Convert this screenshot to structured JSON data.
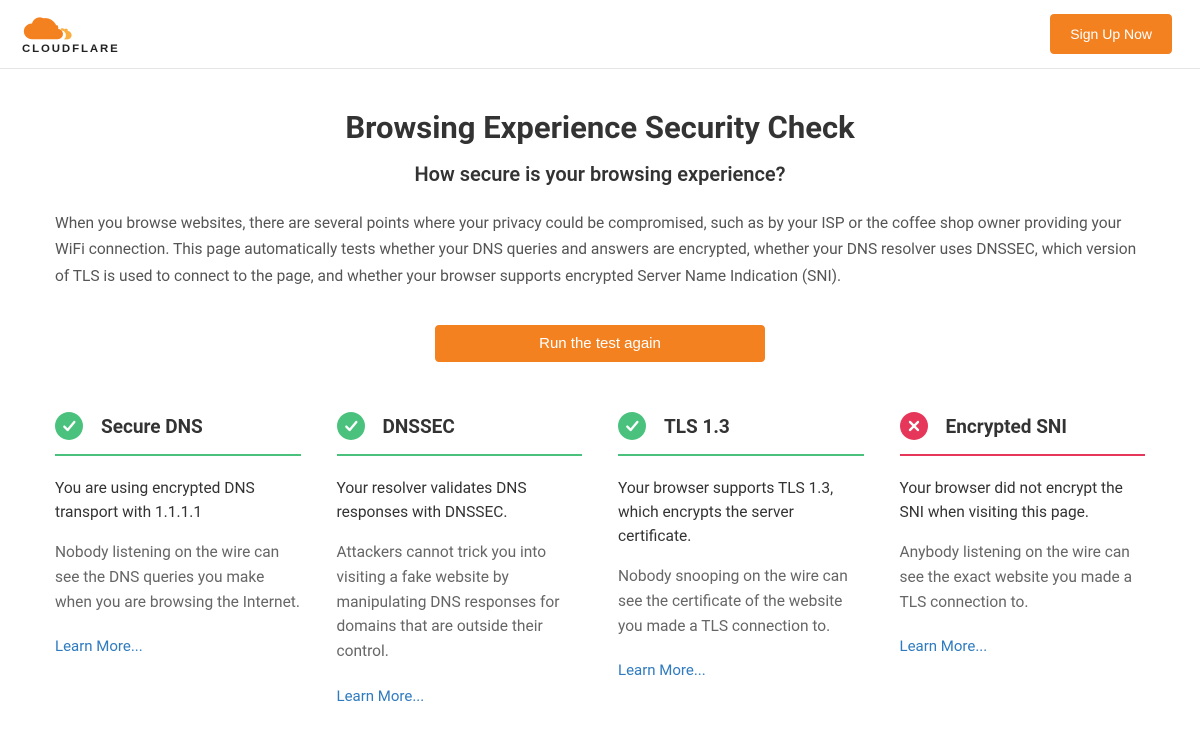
{
  "header": {
    "logo_text": "CLOUDFLARE",
    "signup_label": "Sign Up Now"
  },
  "page": {
    "title": "Browsing Experience Security Check",
    "subtitle": "How secure is your browsing experience?",
    "intro": "When you browse websites, there are several points where your privacy could be compromised, such as by your ISP or the coffee shop owner providing your WiFi connection. This page automatically tests whether your DNS queries and answers are encrypted, whether your DNS resolver uses DNSSEC, which version of TLS is used to connect to the page, and whether your browser supports encrypted Server Name Indication (SNI).",
    "run_test_label": "Run the test again"
  },
  "cards": [
    {
      "status": "success",
      "title": "Secure DNS",
      "summary": "You are using encrypted DNS transport with 1.1.1.1",
      "detail": "Nobody listening on the wire can see the DNS queries you make when you are browsing the Internet.",
      "learn_more": "Learn More..."
    },
    {
      "status": "success",
      "title": "DNSSEC",
      "summary": "Your resolver validates DNS responses with DNSSEC.",
      "detail": "Attackers cannot trick you into visiting a fake website by manipulating DNS responses for domains that are outside their control.",
      "learn_more": "Learn More..."
    },
    {
      "status": "success",
      "title": "TLS 1.3",
      "summary": "Your browser supports TLS 1.3, which encrypts the server certificate.",
      "detail": "Nobody snooping on the wire can see the certificate of the website you made a TLS connection to.",
      "learn_more": "Learn More..."
    },
    {
      "status": "fail",
      "title": "Encrypted SNI",
      "summary": "Your browser did not encrypt the SNI when visiting this page.",
      "detail": "Anybody listening on the wire can see the exact website you made a TLS connection to.",
      "learn_more": "Learn More..."
    }
  ]
}
